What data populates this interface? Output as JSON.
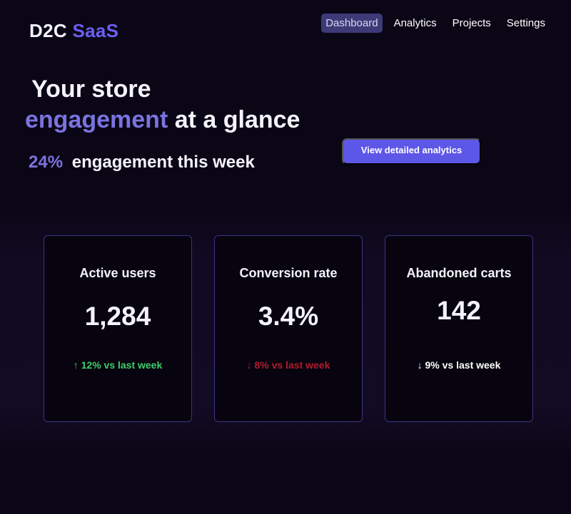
{
  "brand": {
    "name": "D2C",
    "accent": "SaaS"
  },
  "nav": {
    "items": [
      {
        "label": "Dashboard",
        "active": true
      },
      {
        "label": "Analytics",
        "active": false
      },
      {
        "label": "Projects",
        "active": false
      },
      {
        "label": "Settings",
        "active": false
      }
    ]
  },
  "hero": {
    "line1": "Your store",
    "line2_accent": "engagement",
    "line2_rest": "at a glance",
    "stat_value": "24%",
    "stat_text": "engagement this week",
    "cta_label": "View detailed analytics"
  },
  "cards": [
    {
      "label": "Active users",
      "value": "1,284",
      "delta": "↑ 12% vs last week",
      "trend": "up"
    },
    {
      "label": "Conversion rate",
      "value": "3.4%",
      "delta": "↓ 8% vs last week",
      "trend": "down"
    },
    {
      "label": "Abandoned carts",
      "value": "142",
      "delta": "↓ 9% vs last week",
      "trend": "neutral"
    }
  ],
  "colors": {
    "background": "#0b0616",
    "accent": "#7a73e0",
    "button": "#5d57e8",
    "nav_active": "#3e3a78",
    "card_border": "#3a3484",
    "positive": "#3ecf6a",
    "negative": "#b21c2c"
  }
}
